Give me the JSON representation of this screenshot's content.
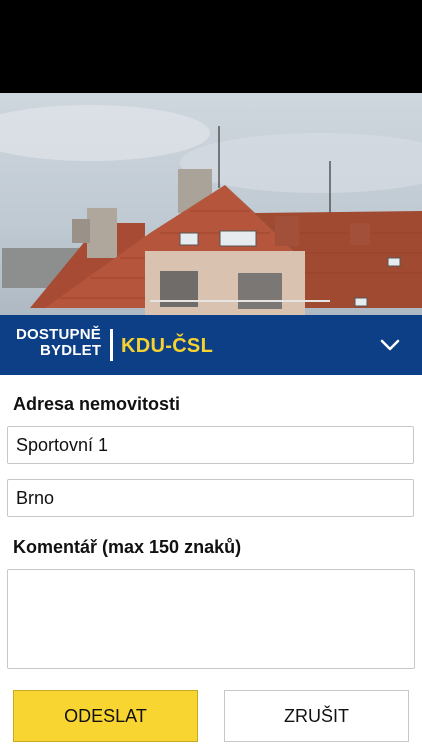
{
  "header": {
    "brand_line1": "DOSTUPNĚ",
    "brand_line2": "BYDLET",
    "party": "KDU-ČSL",
    "colors": {
      "bar": "#0d3f86",
      "party_text": "#f6d22e"
    }
  },
  "photo": {
    "icon": "building-photo"
  },
  "form": {
    "address_label": "Adresa nemovitosti",
    "street_value": "Sportovní 1",
    "city_value": "Brno",
    "comment_label": "Komentář (max 150 znaků)",
    "comment_value": ""
  },
  "buttons": {
    "send_label": "ODESLAT",
    "cancel_label": "ZRUŠIT",
    "send_color": "#f9d532"
  }
}
